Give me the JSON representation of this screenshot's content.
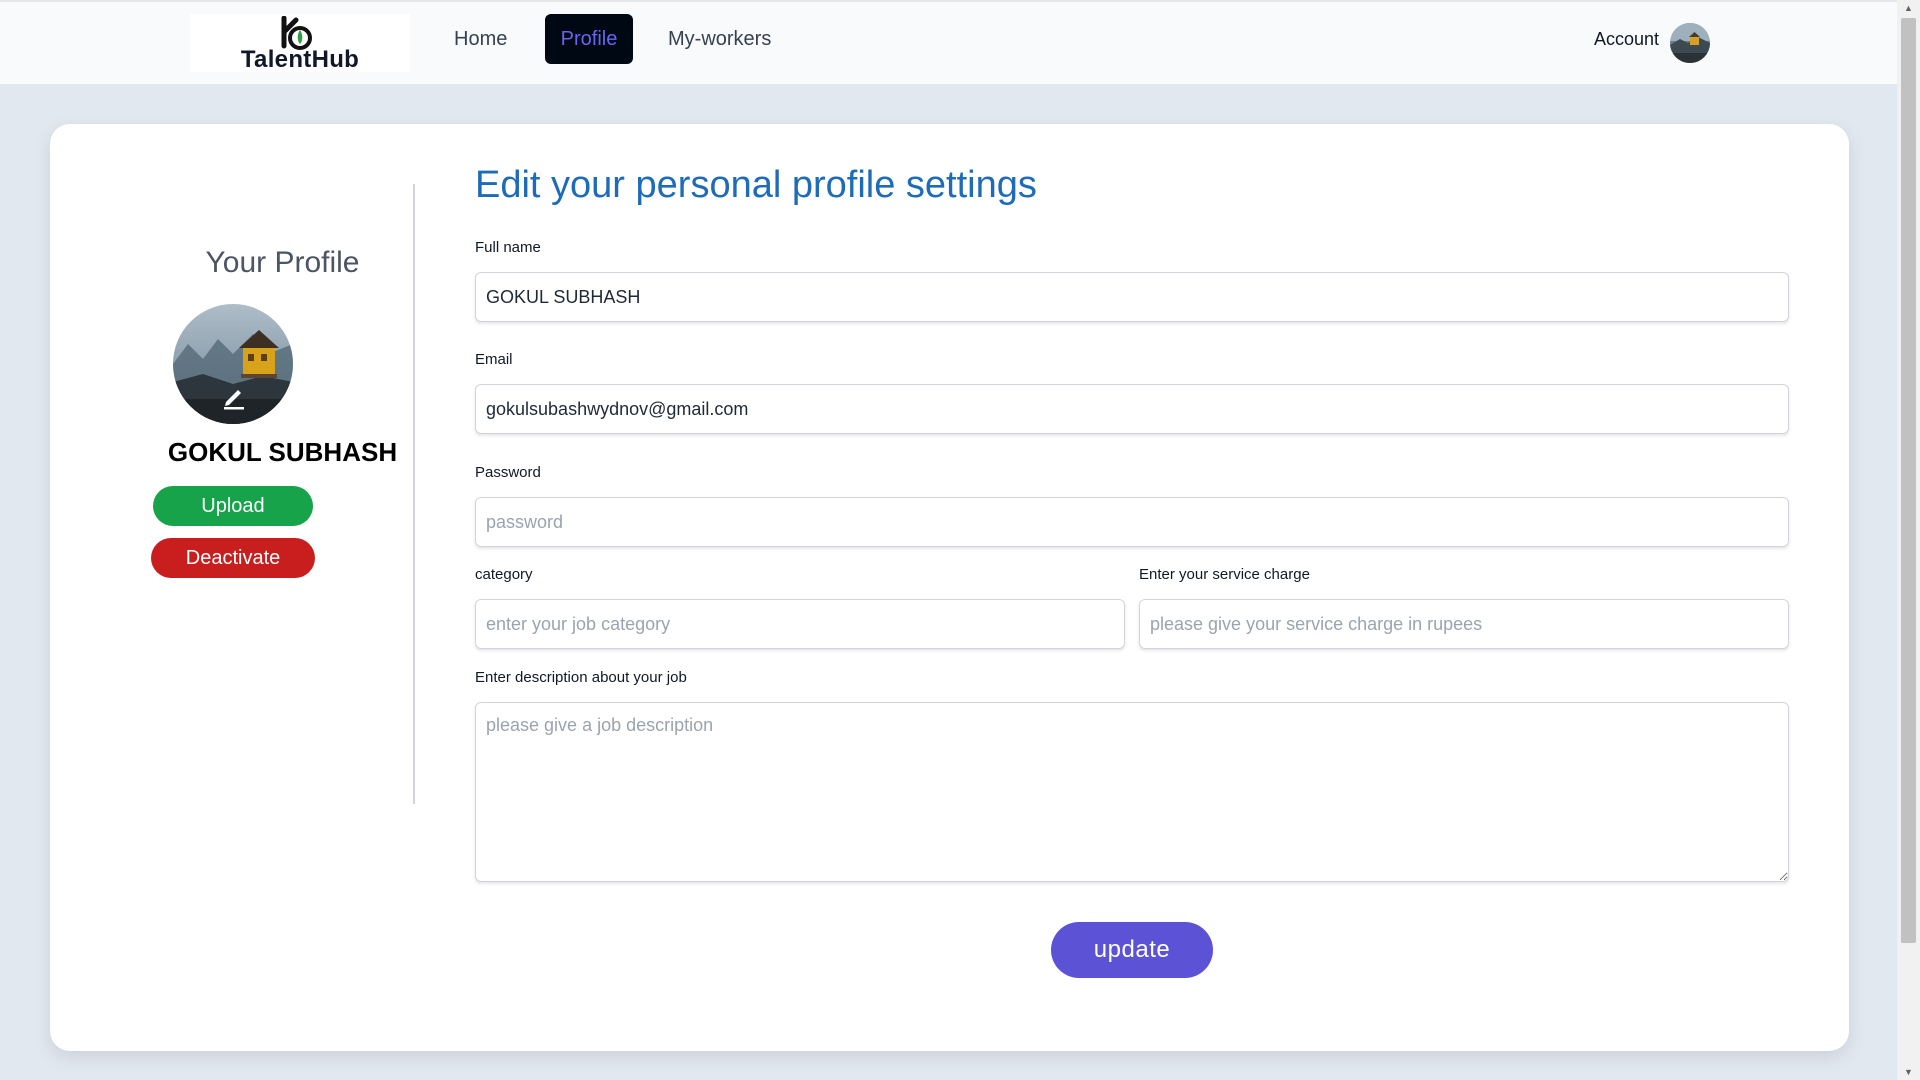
{
  "nav": {
    "brand": "TalentHub",
    "links": [
      {
        "label": "Home"
      },
      {
        "label": "Profile",
        "active": true
      },
      {
        "label": "My-workers"
      }
    ],
    "account_label": "Account",
    "accent_color": "#6366f1"
  },
  "sidebar": {
    "heading": "Your Profile",
    "name": "GOKUL SUBHASH",
    "edit_icon": "pencil-icon",
    "upload_label": "Upload",
    "deactivate_label": "Deactivate",
    "upload_color": "#16a34a",
    "deactivate_color": "#c81e1e"
  },
  "form": {
    "title": "Edit your personal profile settings",
    "full_name": {
      "label": "Full name",
      "value": "GOKUL SUBHASH"
    },
    "email": {
      "label": "Email",
      "value": "gokulsubashwydnov@gmail.com"
    },
    "password": {
      "label": "Password",
      "placeholder": "password"
    },
    "category": {
      "label": "category",
      "placeholder": "enter your job category"
    },
    "service_charge": {
      "label": "Enter your service charge",
      "placeholder": "please give your service charge in rupees"
    },
    "description": {
      "label": "Enter description about your job",
      "placeholder": "please give a job description"
    },
    "update_label": "update",
    "update_color": "#5b52d6"
  }
}
